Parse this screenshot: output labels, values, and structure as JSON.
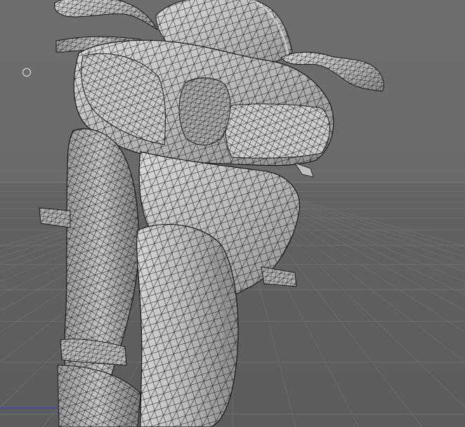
{
  "viewport": {
    "label": "",
    "colors": {
      "background_upper": "#6e6e6e",
      "background_lower": "#5c5c5c",
      "horizon": "#8a8a8a",
      "grid_major": "#7a7a7a",
      "grid_minor": "#666666",
      "mesh_fill": "#b9b9b9",
      "mesh_light": "#dcdcdc",
      "mesh_shadow": "#8f8f8f",
      "wire": "#1a1a1a",
      "axis_x": "#3a3fd0"
    },
    "model": {
      "name_icon": "motorcycle-wireframe-model",
      "display_mode": "shaded-wireframe"
    },
    "cursor_icon": "circle-cursor-icon"
  }
}
